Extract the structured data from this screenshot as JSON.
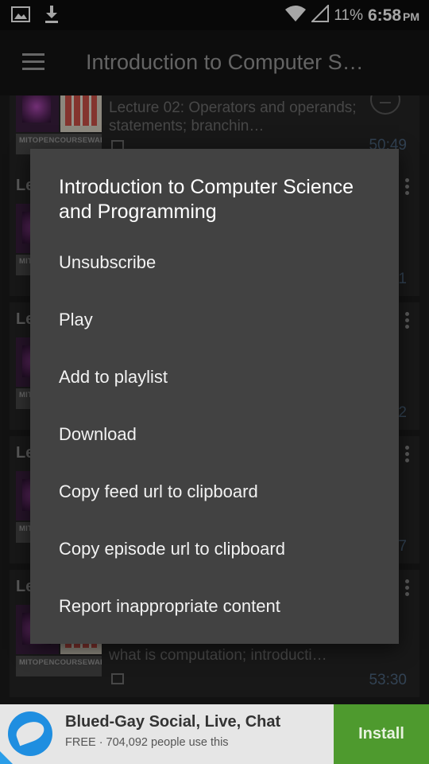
{
  "status_bar": {
    "battery": "11%",
    "time": "6:58",
    "ampm": "PM",
    "icons": [
      "image-icon",
      "download-icon",
      "wifi-icon",
      "signal-icon"
    ]
  },
  "app_bar": {
    "title": "Introduction to Computer S…"
  },
  "list": {
    "cards": [
      {
        "letter": "",
        "text": "Lecture 02: Operators and operands; statements; branchin…",
        "duration": "50:49",
        "thumb_caption": "MITOPENCOURSEWARE"
      },
      {
        "letter": "Le",
        "text": "",
        "duration": "1",
        "thumb_caption": "MITOPENCOURSEWARE"
      },
      {
        "letter": "Le",
        "text": "",
        "duration": "2",
        "thumb_caption": "MITOPENCOURSEWARE"
      },
      {
        "letter": "Le",
        "text": "",
        "duration": "7",
        "thumb_caption": "MITOPENCOURSEWARE"
      },
      {
        "letter": "Le",
        "text": "what is computation; introducti…",
        "duration": "53:30",
        "thumb_caption": "MITOPENCOURSEWARE"
      }
    ]
  },
  "dialog": {
    "title": "Introduction to Computer Science and Programming",
    "items": [
      "Unsubscribe",
      "Play",
      "Add to playlist",
      "Download",
      "Copy feed url to clipboard",
      "Copy episode url to clipboard",
      "Report inappropriate content"
    ]
  },
  "ad": {
    "title": "Blued-Gay Social, Live, Chat",
    "subtitle": "FREE · 704,092 people use this",
    "install_label": "Install"
  },
  "colors": {
    "ad_install": "#4e9a2e",
    "dialog_bg": "#424242",
    "duration": "#4d6680"
  }
}
